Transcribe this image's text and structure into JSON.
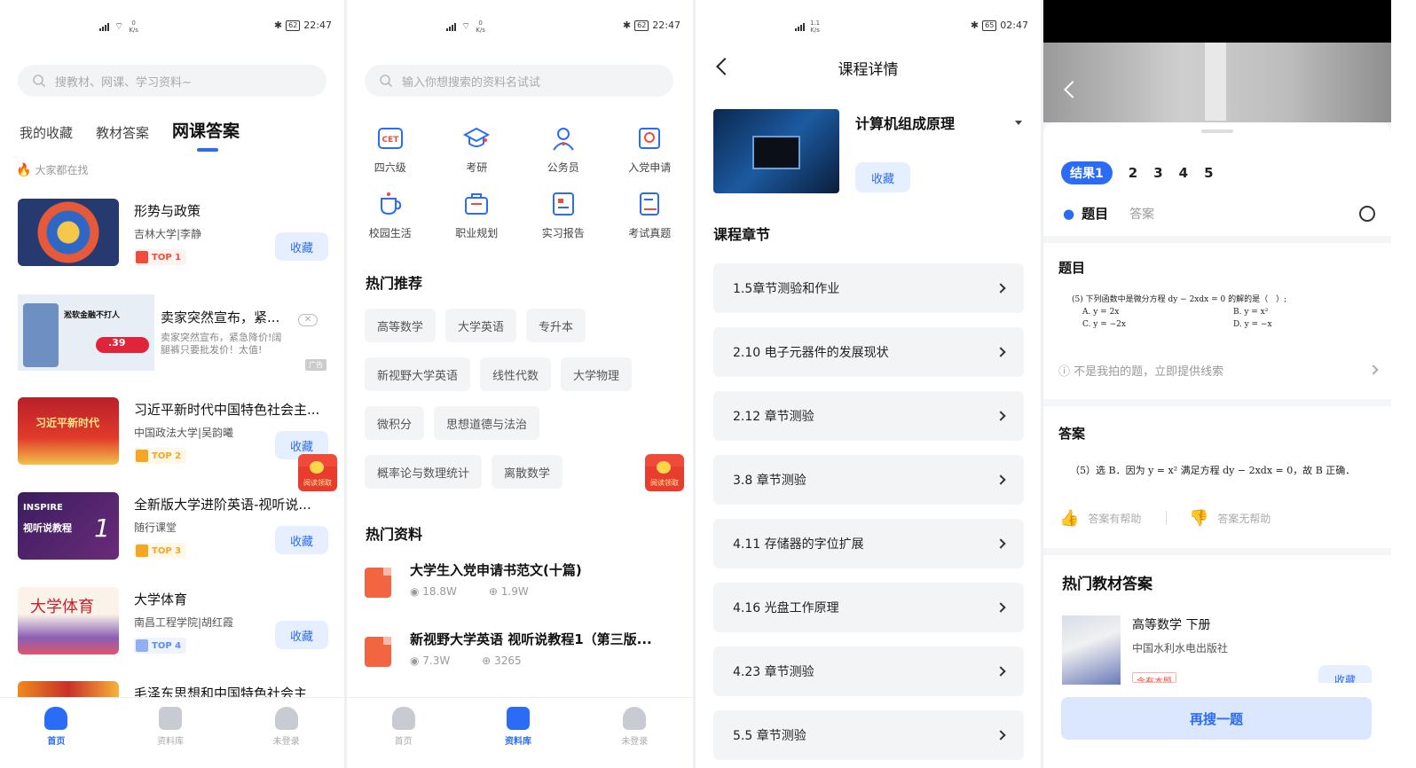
{
  "screen1": {
    "status": {
      "time": "22:47",
      "battery": "62",
      "net": "0",
      "unit": "K/s",
      "net_type": "2G"
    },
    "search_placeholder": "搜教材、网课、学习资料~",
    "tabs": [
      "我的收藏",
      "教材答案",
      "网课答案"
    ],
    "hot_label": "大家都在找",
    "courses": [
      {
        "title": "形势与政策",
        "sub": "吉林大学|李静",
        "rank": "TOP 1",
        "fav": "收藏"
      },
      {
        "title": "习近平新时代中国特色社会主...",
        "sub": "中国政法大学|吴韵曦",
        "rank": "TOP 2",
        "fav": "收藏"
      },
      {
        "title": "全新版大学进阶英语-视听说...",
        "sub": "随行课堂",
        "rank": "TOP 3",
        "fav": "收藏"
      },
      {
        "title": "大学体育",
        "sub": "南昌工程学院|胡红霞",
        "rank": "TOP 4",
        "fav": "收藏"
      },
      {
        "title": "毛泽东思想和中国特色社会主"
      }
    ],
    "ad": {
      "title": "卖家突然宣布，紧...",
      "desc": "卖家突然宣布，紧急降价!阔腿裤只要批发价！太值!",
      "tag": "广告",
      "close": "✕",
      "price": ".39",
      "banner": "淞软金融不打人"
    },
    "thumb_text": {
      "c2": "习近平新时代",
      "c3a": "INSPIRE",
      "c3b": "视听说教程",
      "c4": "大学体育"
    },
    "redpacket": "阅读领取",
    "nav": [
      "首页",
      "资料库",
      "未登录"
    ]
  },
  "screen2": {
    "status": {
      "time": "22:47",
      "battery": "62",
      "net": "0",
      "unit": "K/s",
      "net_type": "2G"
    },
    "search_placeholder": "输入你想搜索的资料名试试",
    "grid": [
      "四六级",
      "考研",
      "公务员",
      "入党申请",
      "校园生活",
      "职业规划",
      "实习报告",
      "考试真题"
    ],
    "cet_label": "CET",
    "hot_rec": "热门推荐",
    "chips": [
      "高等数学",
      "大学英语",
      "专升本",
      "新视野大学英语",
      "线性代数",
      "大学物理",
      "微积分",
      "思想道德与法治",
      "概率论与数理统计",
      "离散数学"
    ],
    "hot_docs": "热门资料",
    "docs": [
      {
        "title": "大学生入党申请书范文(十篇)",
        "views": "18.8W",
        "downloads": "1.9W"
      },
      {
        "title": "新视野大学英语 视听说教程1（第三版...",
        "views": "7.3W",
        "downloads": "3265"
      }
    ],
    "redpacket": "阅读领取",
    "nav": [
      "首页",
      "资料库",
      "未登录"
    ]
  },
  "screen3": {
    "status": {
      "time": "02:47",
      "battery": "65",
      "net": "1.1",
      "unit": "K/s",
      "net_type": "4G"
    },
    "title": "课程详情",
    "course_name": "计算机组成原理",
    "fav": "收藏",
    "section": "课程章节",
    "chapters": [
      "1.5章节测验和作业",
      "2.10 电子元器件的发展现状",
      "2.12 章节测验",
      "3.8 章节测验",
      "4.11 存储器的字位扩展",
      "4.16 光盘工作原理",
      "4.23 章节测验",
      "5.5 章节测验"
    ]
  },
  "screen4": {
    "pager": [
      "结果1",
      "2",
      "3",
      "4",
      "5"
    ],
    "tab_question": "题目",
    "tab_answer": "答案",
    "q_title": "题目",
    "q_text": "(5) 下列函数中是微分方程 dy − 2xdx = 0 的解的是（　）;",
    "options": [
      "A.  y = 2x",
      "B.  y = x²",
      "C.  y = −2x",
      "D.  y = −x"
    ],
    "not_mine": "不是我拍的题，立即提供线索",
    "a_title": "答案",
    "a_text": "（5）选 B．因为 y = x² 满足方程 dy − 2xdx = 0，故 B 正确．",
    "helpful": "答案有帮助",
    "unhelpful": "答案无帮助",
    "hot_books": "热门教材答案",
    "book": {
      "title": "高等数学 下册",
      "publisher": "中国水利水电出版社",
      "tag": "含有本题",
      "fav": "收藏"
    },
    "research": "再搜一题"
  },
  "colors": {
    "accent": "#2b6cf6",
    "chip_bg": "#f3f4f6",
    "pdf": "#f26541"
  }
}
